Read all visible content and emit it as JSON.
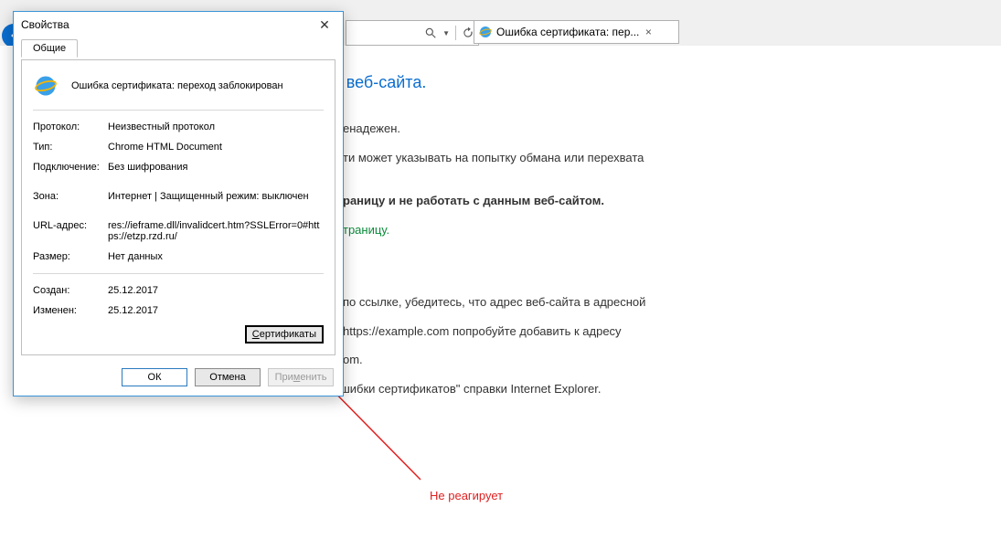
{
  "chrome": {
    "tab_title": "Ошибка сертификата: пер..."
  },
  "page": {
    "heading_suffix": "безопасности этого веб-сайта.",
    "line1_suffix": "енадежен.",
    "line2_suffix": "ти может указывать на попытку обмана или перехвата",
    "line3_suffix": "раницу и не работать с данным веб-сайтом.",
    "link_suffix": "траницу.",
    "para4_suffix": "по ссылке, убедитесь, что адрес веб-сайта в адресной",
    "para5a_suffix": "https://example.com попробуйте добавить к адресу",
    "para5b_suffix": "om.",
    "para6": "Дополнительные сведения см. в разделе \"Ошибки сертификатов\" справки Internet Explorer."
  },
  "dialog": {
    "title": "Свойства",
    "tab": "Общие",
    "doc_title": "Ошибка сертификата: переход заблокирован",
    "labels": {
      "protocol": "Протокол:",
      "type": "Тип:",
      "connection": "Подключение:",
      "zone": "Зона:",
      "url": "URL-адрес:",
      "size": "Размер:",
      "created": "Создан:",
      "modified": "Изменен:"
    },
    "values": {
      "protocol": "Неизвестный протокол",
      "type": "Chrome HTML Document",
      "connection": "Без шифрования",
      "zone": "Интернет | Защищенный режим: выключен",
      "url": "res://ieframe.dll/invalidcert.htm?SSLError=0#https://etzp.rzd.ru/",
      "size": "Нет данных",
      "created": "25.12.2017",
      "modified": "25.12.2017"
    },
    "buttons": {
      "certificates": "Сертификаты",
      "ok": "ОК",
      "cancel": "Отмена",
      "apply": "Применить"
    }
  },
  "annotation": {
    "text": "Не реагирует",
    "color": "#e02020"
  }
}
